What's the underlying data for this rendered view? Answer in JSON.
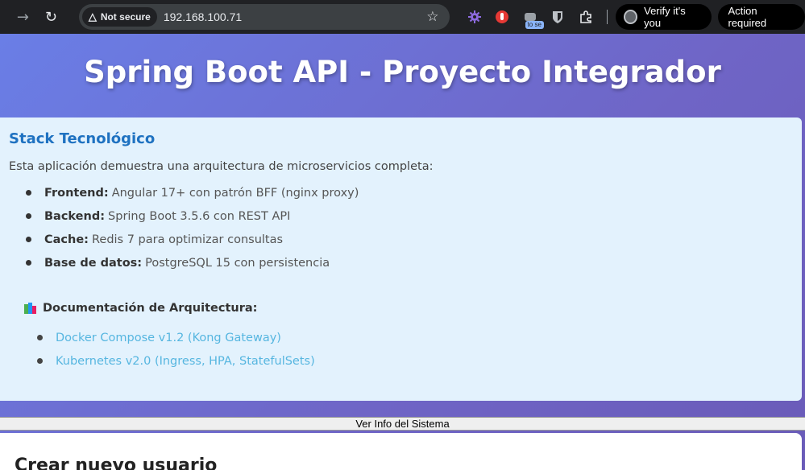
{
  "browser": {
    "security_label": "Not secure",
    "url": "192.168.100.71",
    "extension_badge": "to se",
    "verify_label": "Verify it's you",
    "action_label": "Action required"
  },
  "page": {
    "title": "Spring Boot API - Proyecto Integrador",
    "stack": {
      "heading": "Stack Tecnológico",
      "intro": "Esta aplicación demuestra una arquitectura de microservicios completa:",
      "items": [
        {
          "key": "Frontend:",
          "value": "Angular 17+ con patrón BFF (nginx proxy)"
        },
        {
          "key": "Backend:",
          "value": "Spring Boot 3.5.6 con REST API"
        },
        {
          "key": "Cache:",
          "value": "Redis 7 para optimizar consultas"
        },
        {
          "key": "Base de datos:",
          "value": "PostgreSQL 15 con persistencia"
        }
      ],
      "docs_heading": "Documentación de Arquitectura:",
      "docs": [
        {
          "label": "Docker Compose v1.2 (Kong Gateway)"
        },
        {
          "label": "Kubernetes v2.0 (Ingress, HPA, StatefulSets)"
        }
      ]
    },
    "info_button": "Ver Info del Sistema",
    "create_heading": "Crear nuevo usuario"
  }
}
